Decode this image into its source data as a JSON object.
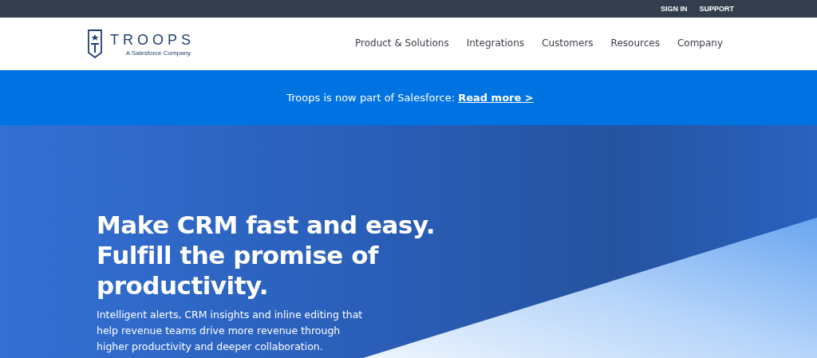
{
  "top_bar": {
    "links": [
      "SIGN IN",
      "SUPPORT"
    ]
  },
  "header": {
    "logo": {
      "name": "TROOPS",
      "tagline": "A Salesforce Company"
    },
    "nav": [
      "Product & Solutions",
      "Integrations",
      "Customers",
      "Resources",
      "Company"
    ]
  },
  "banner": {
    "text": "Troops is now part of Salesforce:",
    "link": "Read more >"
  },
  "hero": {
    "headline_lines": [
      "Make CRM fast and easy.",
      "Fulfill the promise of",
      "productivity."
    ],
    "description_lines": [
      "Intelligent alerts, CRM insights and inline editing that",
      "help revenue teams drive more revenue through",
      "higher productivity and deeper collaboration."
    ]
  }
}
